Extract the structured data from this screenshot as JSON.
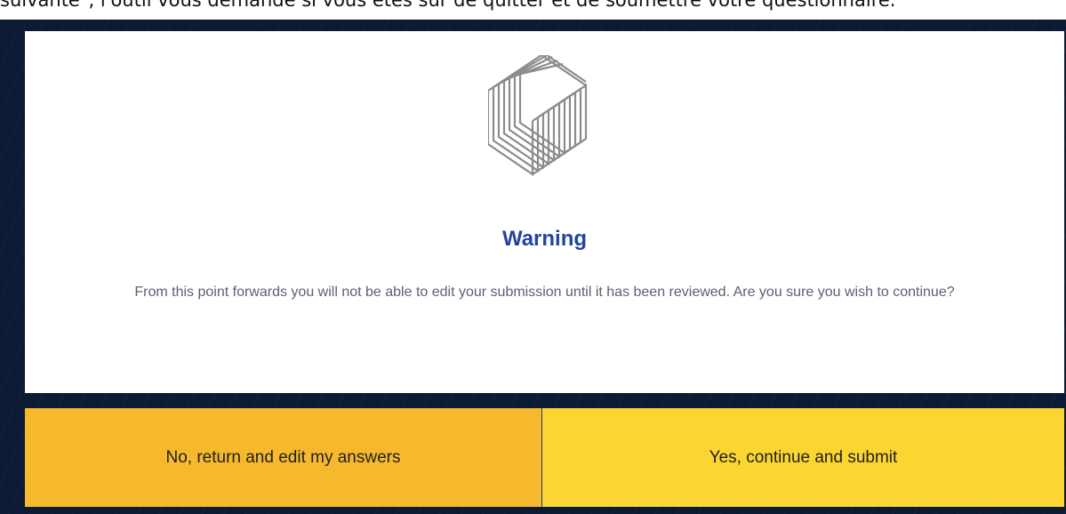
{
  "header_text": "suivante\", l'outil vous demande si vous êtes sûr de quitter et de soumettre votre questionnaire.",
  "dialog": {
    "title": "Warning",
    "message": "From this point forwards you will not be able to edit your submission until it has been reviewed. Are you sure you wish to continue?",
    "logo_icon": "cube-lines-logo",
    "title_color": "#2343a3"
  },
  "buttons": {
    "no_label": "No, return and edit my answers",
    "yes_label": "Yes, continue and submit",
    "no_color": "#f6b92e",
    "yes_color": "#fbd532"
  },
  "backdrop_color": "#0d1a33"
}
